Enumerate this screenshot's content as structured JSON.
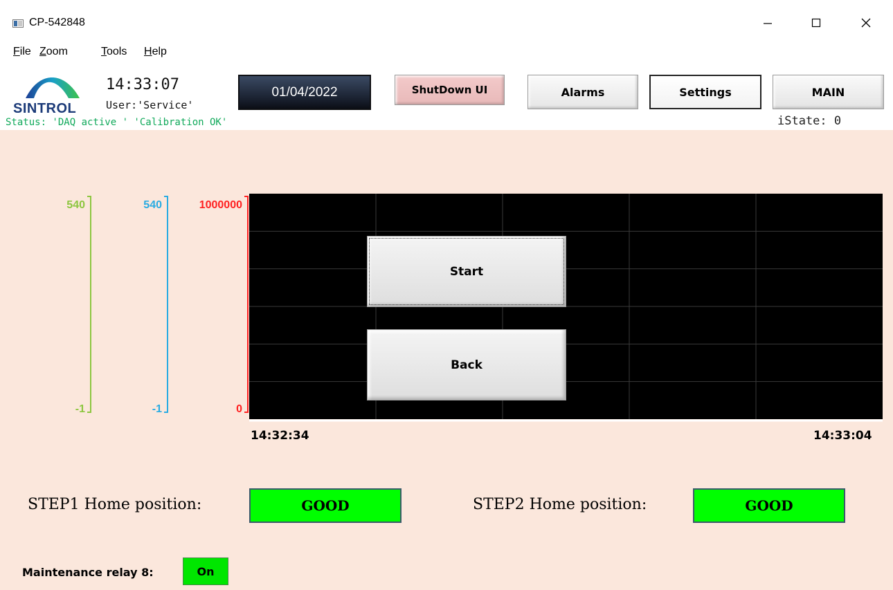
{
  "window": {
    "title": "CP-542848",
    "controls": {
      "minimize_icon": "minimize-icon",
      "maximize_icon": "maximize-icon",
      "close_icon": "close-icon"
    }
  },
  "menu": {
    "items": [
      "File",
      "Zoom",
      "Tools",
      "Help"
    ]
  },
  "header": {
    "logo_text": "SINTROL",
    "time": "14:33:07",
    "user": "User:'Service'",
    "date": "01/04/2022",
    "buttons": {
      "shutdown": "ShutDown UI",
      "alarms": "Alarms",
      "settings": "Settings",
      "main": "MAIN"
    },
    "status": "Status: 'DAQ active ' 'Calibration OK'",
    "istate": "iState: 0"
  },
  "chart_data": {
    "type": "line",
    "axes": [
      {
        "color": "#8cc63f",
        "max": "540",
        "min": "-1"
      },
      {
        "color": "#29abe2",
        "max": "540",
        "min": "-1"
      },
      {
        "color": "#ff2020",
        "max": "1000000",
        "min": "0"
      }
    ],
    "x_ticks": [
      "14:32:34",
      "14:33:04"
    ],
    "xlim": [
      "14:32:34",
      "14:33:04"
    ],
    "series": [],
    "grid": true
  },
  "chart_buttons": {
    "start": "Start",
    "back": "Back"
  },
  "status_panel": {
    "step1_label": "STEP1 Home position:",
    "step1_value": "GOOD",
    "step2_label": "STEP2 Home position:",
    "step2_value": "GOOD",
    "relay_label": "Maintenance relay 8:",
    "relay_value": "On"
  },
  "colors": {
    "background": "#fbe7dc",
    "good": "#00ff00",
    "status_text": "#10a95a"
  }
}
